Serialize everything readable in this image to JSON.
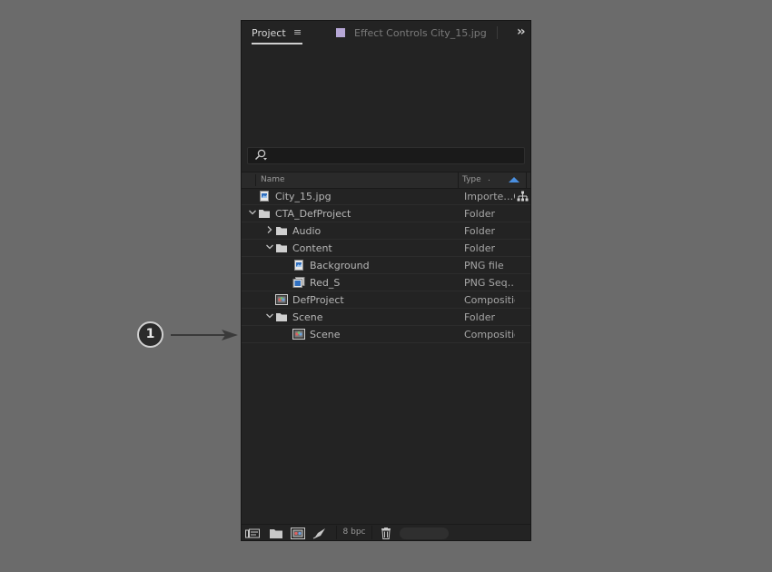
{
  "tabs": {
    "project_label": "Project",
    "project_menu_icon": "hamburger-icon",
    "effect_controls_label": "Effect Controls City_15.jpg",
    "effect_swatch_color": "#b6a7d6",
    "overflow_icon": "double-chevron-right-icon"
  },
  "search": {
    "icon": "search-icon",
    "value": ""
  },
  "columns": {
    "name": "Name",
    "type": "Type",
    "extra": ".",
    "sort": "ascending"
  },
  "items": [
    {
      "name": "City_15.jpg",
      "type": "Importe…G",
      "icon": "image-file-icon",
      "depth": 0,
      "twisty": "none"
    },
    {
      "name": "CTA_DefProject",
      "type": "Folder",
      "icon": "folder-icon",
      "depth": 0,
      "twisty": "expanded"
    },
    {
      "name": "Audio",
      "type": "Folder",
      "icon": "folder-icon",
      "depth": 1,
      "twisty": "collapsed"
    },
    {
      "name": "Content",
      "type": "Folder",
      "icon": "folder-icon",
      "depth": 1,
      "twisty": "expanded"
    },
    {
      "name": "Background",
      "type": "PNG file",
      "icon": "image-file-icon",
      "depth": 2,
      "twisty": "none"
    },
    {
      "name": "Red_S",
      "type": "PNG Seq…e",
      "icon": "image-sequence-icon",
      "depth": 2,
      "twisty": "none"
    },
    {
      "name": "DefProject",
      "type": "Compositio",
      "icon": "composition-icon",
      "depth": 1,
      "twisty": "none"
    },
    {
      "name": "Scene",
      "type": "Folder",
      "icon": "folder-icon",
      "depth": 1,
      "twisty": "expanded"
    },
    {
      "name": "Scene",
      "type": "Compositio",
      "icon": "composition-icon",
      "depth": 2,
      "twisty": "none"
    }
  ],
  "footer": {
    "bpc": "8 bpc",
    "icons": [
      "interpret-footage-icon",
      "new-folder-icon",
      "new-composition-icon",
      "render-queue-icon",
      "trash-icon"
    ]
  },
  "callout": {
    "number": "1"
  }
}
